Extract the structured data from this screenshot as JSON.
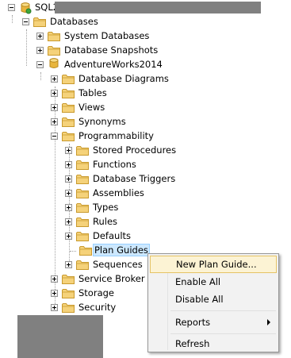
{
  "tree": {
    "server_label": "SQL2",
    "databases": "Databases",
    "system_databases": "System Databases",
    "database_snapshots": "Database Snapshots",
    "adventureworks": "AdventureWorks2014",
    "database_diagrams": "Database Diagrams",
    "tables": "Tables",
    "views": "Views",
    "synonyms": "Synonyms",
    "programmability": "Programmability",
    "stored_procedures": "Stored Procedures",
    "functions": "Functions",
    "database_triggers": "Database Triggers",
    "assemblies": "Assemblies",
    "types": "Types",
    "rules": "Rules",
    "defaults": "Defaults",
    "plan_guides": "Plan Guides",
    "sequences": "Sequences",
    "service_broker": "Service Broker",
    "storage": "Storage",
    "security": "Security"
  },
  "context_menu": {
    "new_plan_guide": "New Plan Guide...",
    "enable_all": "Enable All",
    "disable_all": "Disable All",
    "reports": "Reports",
    "refresh": "Refresh"
  },
  "colors": {
    "folder": "#e8c25a",
    "folder_dark": "#c99a2e",
    "selection": "#cce8ff",
    "menu_hover": "#fcf3d4"
  }
}
